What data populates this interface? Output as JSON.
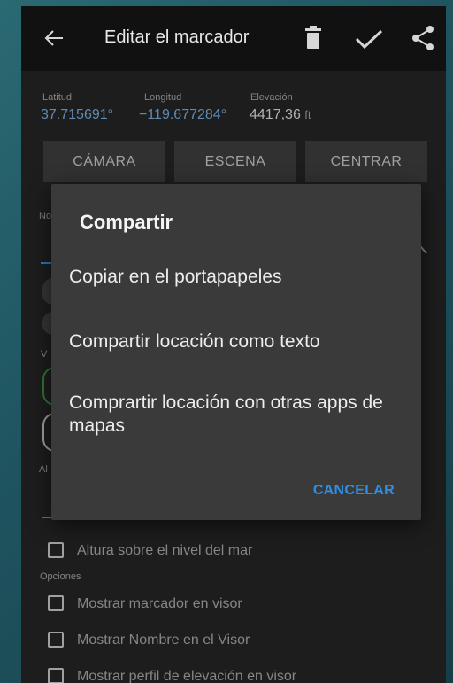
{
  "appbar": {
    "title": "Editar el marcador",
    "back_icon": "arrow-back-icon",
    "delete_icon": "trash-icon",
    "confirm_icon": "checkmark-icon",
    "share_icon": "share-icon"
  },
  "coords": {
    "lat_label": "Latitud",
    "lat_value": "37.715691°",
    "lon_label": "Longitud",
    "lon_value": "−119.677284°",
    "elev_label": "Elevación",
    "elev_value": "4417,36",
    "elev_unit": "ft"
  },
  "buttons": {
    "camera": "CÁMARA",
    "scene": "ESCENA",
    "center": "CENTRAR"
  },
  "background_fragments": {
    "name_label": "No",
    "v_label": "V",
    "al_label": "Al"
  },
  "checkboxes": {
    "altitude": "Altura sobre el nivel del mar",
    "show_marker": "Mostrar marcador en visor",
    "show_name": "Mostrar Nombre en el Visor",
    "show_elevation": "Mostrar perfil de elevación en visor"
  },
  "options_label": "Opciones",
  "dialog": {
    "title": "Compartir",
    "option_copy": "Copiar en el portapapeles",
    "option_text": "Compartir locación como texto",
    "option_apps": "Comprartir locación con otras apps de mapas",
    "cancel": "CANCELAR"
  },
  "colors": {
    "accent": "#2f8fe5",
    "coord_value": "#6fa3d6",
    "appbar": "#111111",
    "dialog": "#3a3a3a"
  }
}
